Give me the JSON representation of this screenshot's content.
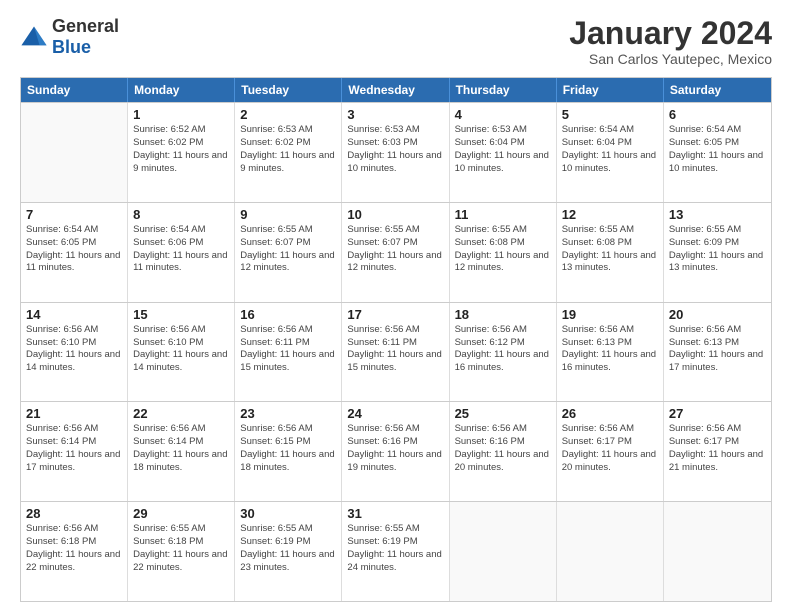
{
  "header": {
    "logo": {
      "general": "General",
      "blue": "Blue"
    },
    "title": "January 2024",
    "subtitle": "San Carlos Yautepec, Mexico"
  },
  "weekdays": [
    "Sunday",
    "Monday",
    "Tuesday",
    "Wednesday",
    "Thursday",
    "Friday",
    "Saturday"
  ],
  "weeks": [
    [
      {
        "day": "",
        "empty": true
      },
      {
        "day": "1",
        "sunrise": "6:52 AM",
        "sunset": "6:02 PM",
        "daylight": "11 hours and 9 minutes."
      },
      {
        "day": "2",
        "sunrise": "6:53 AM",
        "sunset": "6:02 PM",
        "daylight": "11 hours and 9 minutes."
      },
      {
        "day": "3",
        "sunrise": "6:53 AM",
        "sunset": "6:03 PM",
        "daylight": "11 hours and 10 minutes."
      },
      {
        "day": "4",
        "sunrise": "6:53 AM",
        "sunset": "6:04 PM",
        "daylight": "11 hours and 10 minutes."
      },
      {
        "day": "5",
        "sunrise": "6:54 AM",
        "sunset": "6:04 PM",
        "daylight": "11 hours and 10 minutes."
      },
      {
        "day": "6",
        "sunrise": "6:54 AM",
        "sunset": "6:05 PM",
        "daylight": "11 hours and 10 minutes."
      }
    ],
    [
      {
        "day": "7",
        "sunrise": "6:54 AM",
        "sunset": "6:05 PM",
        "daylight": "11 hours and 11 minutes."
      },
      {
        "day": "8",
        "sunrise": "6:54 AM",
        "sunset": "6:06 PM",
        "daylight": "11 hours and 11 minutes."
      },
      {
        "day": "9",
        "sunrise": "6:55 AM",
        "sunset": "6:07 PM",
        "daylight": "11 hours and 12 minutes."
      },
      {
        "day": "10",
        "sunrise": "6:55 AM",
        "sunset": "6:07 PM",
        "daylight": "11 hours and 12 minutes."
      },
      {
        "day": "11",
        "sunrise": "6:55 AM",
        "sunset": "6:08 PM",
        "daylight": "11 hours and 12 minutes."
      },
      {
        "day": "12",
        "sunrise": "6:55 AM",
        "sunset": "6:08 PM",
        "daylight": "11 hours and 13 minutes."
      },
      {
        "day": "13",
        "sunrise": "6:55 AM",
        "sunset": "6:09 PM",
        "daylight": "11 hours and 13 minutes."
      }
    ],
    [
      {
        "day": "14",
        "sunrise": "6:56 AM",
        "sunset": "6:10 PM",
        "daylight": "11 hours and 14 minutes."
      },
      {
        "day": "15",
        "sunrise": "6:56 AM",
        "sunset": "6:10 PM",
        "daylight": "11 hours and 14 minutes."
      },
      {
        "day": "16",
        "sunrise": "6:56 AM",
        "sunset": "6:11 PM",
        "daylight": "11 hours and 15 minutes."
      },
      {
        "day": "17",
        "sunrise": "6:56 AM",
        "sunset": "6:11 PM",
        "daylight": "11 hours and 15 minutes."
      },
      {
        "day": "18",
        "sunrise": "6:56 AM",
        "sunset": "6:12 PM",
        "daylight": "11 hours and 16 minutes."
      },
      {
        "day": "19",
        "sunrise": "6:56 AM",
        "sunset": "6:13 PM",
        "daylight": "11 hours and 16 minutes."
      },
      {
        "day": "20",
        "sunrise": "6:56 AM",
        "sunset": "6:13 PM",
        "daylight": "11 hours and 17 minutes."
      }
    ],
    [
      {
        "day": "21",
        "sunrise": "6:56 AM",
        "sunset": "6:14 PM",
        "daylight": "11 hours and 17 minutes."
      },
      {
        "day": "22",
        "sunrise": "6:56 AM",
        "sunset": "6:14 PM",
        "daylight": "11 hours and 18 minutes."
      },
      {
        "day": "23",
        "sunrise": "6:56 AM",
        "sunset": "6:15 PM",
        "daylight": "11 hours and 18 minutes."
      },
      {
        "day": "24",
        "sunrise": "6:56 AM",
        "sunset": "6:16 PM",
        "daylight": "11 hours and 19 minutes."
      },
      {
        "day": "25",
        "sunrise": "6:56 AM",
        "sunset": "6:16 PM",
        "daylight": "11 hours and 20 minutes."
      },
      {
        "day": "26",
        "sunrise": "6:56 AM",
        "sunset": "6:17 PM",
        "daylight": "11 hours and 20 minutes."
      },
      {
        "day": "27",
        "sunrise": "6:56 AM",
        "sunset": "6:17 PM",
        "daylight": "11 hours and 21 minutes."
      }
    ],
    [
      {
        "day": "28",
        "sunrise": "6:56 AM",
        "sunset": "6:18 PM",
        "daylight": "11 hours and 22 minutes."
      },
      {
        "day": "29",
        "sunrise": "6:55 AM",
        "sunset": "6:18 PM",
        "daylight": "11 hours and 22 minutes."
      },
      {
        "day": "30",
        "sunrise": "6:55 AM",
        "sunset": "6:19 PM",
        "daylight": "11 hours and 23 minutes."
      },
      {
        "day": "31",
        "sunrise": "6:55 AM",
        "sunset": "6:19 PM",
        "daylight": "11 hours and 24 minutes."
      },
      {
        "day": "",
        "empty": true
      },
      {
        "day": "",
        "empty": true
      },
      {
        "day": "",
        "empty": true
      }
    ]
  ]
}
